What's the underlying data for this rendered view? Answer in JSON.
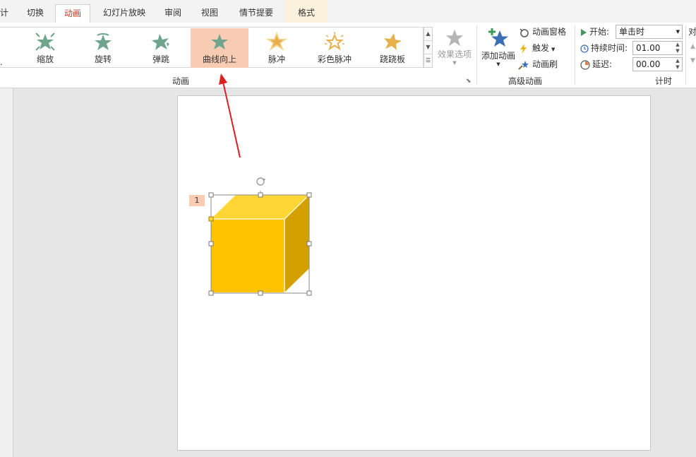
{
  "tabs": [
    {
      "label": "计"
    },
    {
      "label": "切换"
    },
    {
      "label": "动画",
      "active": true
    },
    {
      "label": "幻灯片放映"
    },
    {
      "label": "审阅"
    },
    {
      "label": "视图"
    },
    {
      "label": "情节提要"
    },
    {
      "label": "格式"
    }
  ],
  "gallery": {
    "items": [
      {
        "label": "远..."
      },
      {
        "label": "缩放"
      },
      {
        "label": "旋转"
      },
      {
        "label": "弹跳"
      },
      {
        "label": "曲线向上",
        "selected": true
      },
      {
        "label": "脉冲"
      },
      {
        "label": "彩色脉冲"
      },
      {
        "label": "跷跷板"
      }
    ]
  },
  "effect_options": {
    "label": "效果选项"
  },
  "groups": {
    "animation": "动画",
    "advanced": "高级动画",
    "timing": "计时"
  },
  "advanced": {
    "add_animation": "添加动画",
    "animation_pane": "动画窗格",
    "trigger": "触发",
    "animation_painter": "动画刷"
  },
  "timing": {
    "start_label": "开始:",
    "start_value": "单击时",
    "duration_label": "持续时间:",
    "duration_value": "01.00",
    "delay_label": "延迟:",
    "delay_value": "00.00",
    "reorder_label": "对"
  },
  "slide": {
    "animation_badge": "1"
  },
  "colors": {
    "accent_red": "#c0392b",
    "selected_bg": "#f8cbb3",
    "star_green": "#6fa58c",
    "star_gold": "#e8b04a",
    "cube_front": "#ffc400",
    "cube_top": "#ffd633",
    "cube_side": "#d3a000"
  }
}
